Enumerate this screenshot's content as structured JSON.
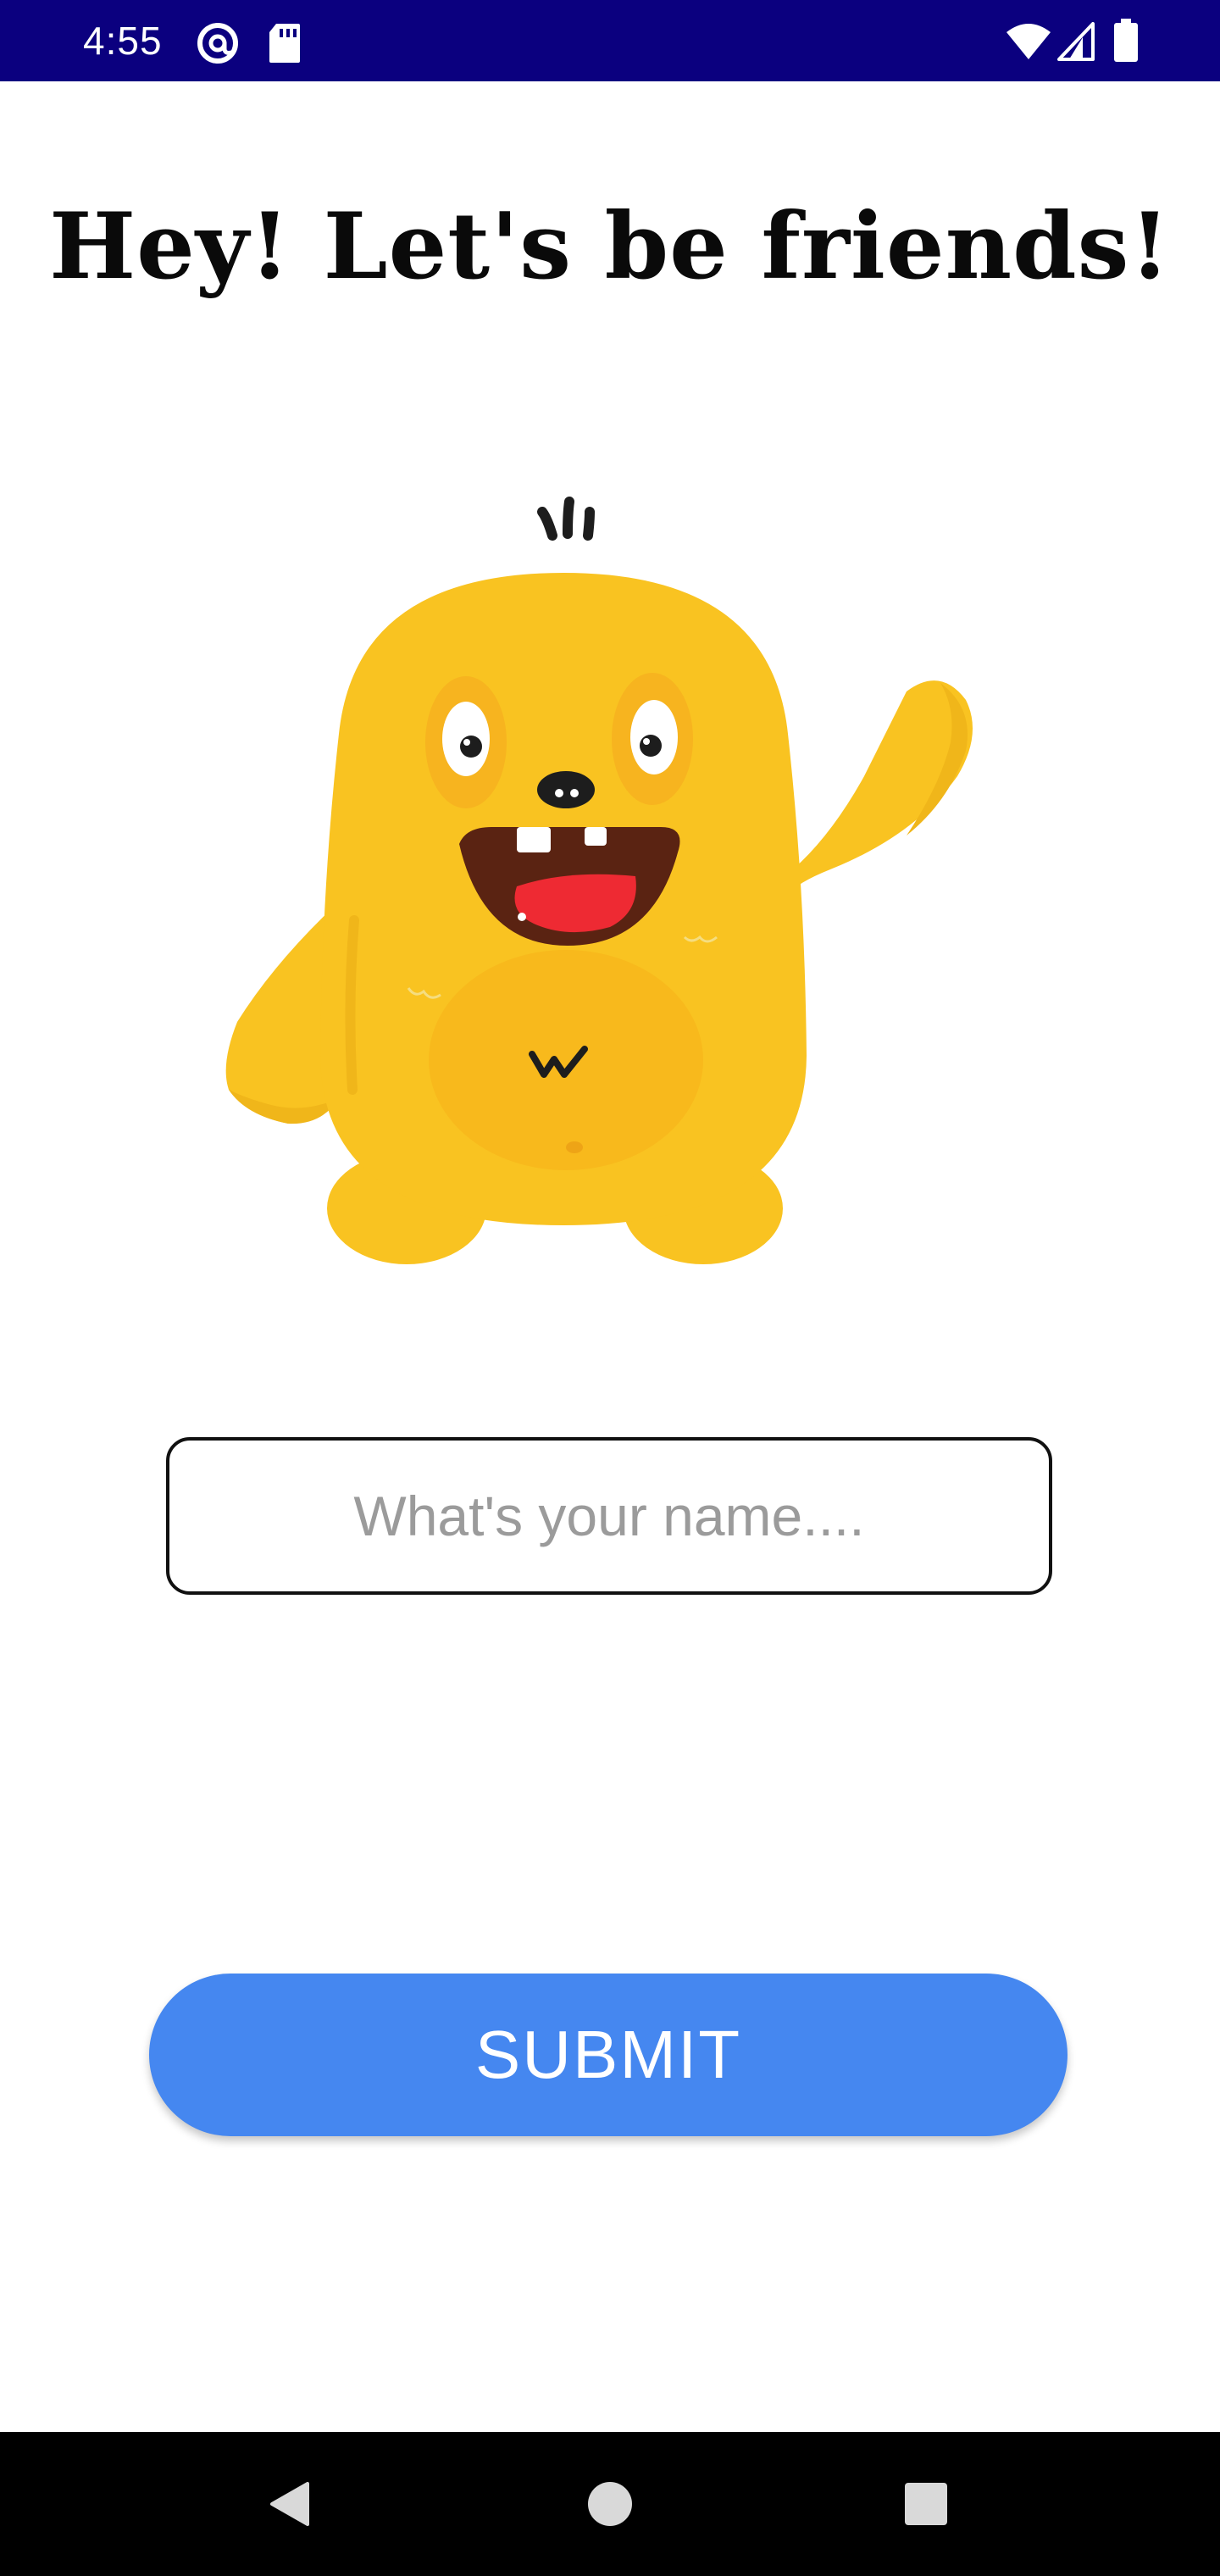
{
  "status_bar": {
    "time": "4:55",
    "left_icons": [
      "at-sign-icon",
      "sd-card-icon"
    ],
    "right_icons": [
      "wifi-icon",
      "cell-signal-icon",
      "battery-icon"
    ],
    "background_color": "#0b007f"
  },
  "main": {
    "headline": "Hey! Let's be friends!",
    "illustration": "yellow-monster-waving",
    "name_input": {
      "value": "",
      "placeholder": "What's your name...."
    },
    "submit_label": "SUBMIT",
    "accent_color": "#4587f0"
  },
  "nav_bar": {
    "icons": [
      "back-icon",
      "home-icon",
      "recents-icon"
    ]
  }
}
